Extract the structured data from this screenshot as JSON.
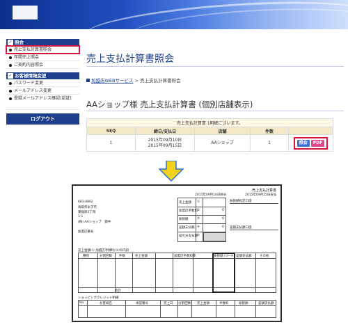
{
  "sidebar": {
    "group1": {
      "title": "照会",
      "items": [
        "売上支払計算書照会",
        "年間売上照会",
        "ご契約内容照会"
      ]
    },
    "group2": {
      "title": "お客様情報変更",
      "items": [
        "パスワード変更",
        "メールアドレス変更",
        "登録メールアドレス確認(認証)"
      ]
    },
    "logout": "ログアウト"
  },
  "main": {
    "title": "売上支払計算書照会",
    "breadcrumb": {
      "link": "加盟店WEBサービス",
      "current": "売上支払計算書照会"
    },
    "subtitle": "AAショップ様 売上支払計算書 (個別店舗表示)",
    "table": {
      "caption": "売上支払計算書 1明細ございます。",
      "headers": [
        "SEQ",
        "締日/支払日",
        "店舗",
        "件数"
      ],
      "row": {
        "seq": "1",
        "close_date": "2015年09月10日",
        "pay_date": "2015年09月15日",
        "shop": "AAショップ",
        "count": "1"
      },
      "view_label": "照会",
      "pdf_label": "PDF"
    }
  },
  "doc": {
    "title": "売上支払計算書",
    "close_date": "2015年09月10日締分",
    "pay_date": "2015年09月15日支払",
    "postal": "683-0802",
    "address1": "鳥取県米子市",
    "address2": "東福原2丁目",
    "address3": "1-1",
    "company": "(株) AAショップ　御中",
    "member_no_label": "加盟店番号",
    "summary": [
      {
        "label": "売上金額",
        "num": "①",
        "value": ""
      },
      {
        "label": "加盟店手数料",
        "num": "②",
        "value": "0"
      },
      {
        "label": "振替額",
        "num": "③",
        "value": "0"
      },
      {
        "label": "差額支払額",
        "num": "④",
        "value": "0"
      },
      {
        "label": "差引お支払額",
        "num": "⑤",
        "value": ""
      }
    ],
    "bank_label": "振替額指定口座",
    "pay_bank_label": "差額支払額口座",
    "section_label": "売上金額(① 加盟店手数料(②)の内訳",
    "col_left": [
      "種別",
      "分割回数",
      "件数",
      "売上金額",
      "加盟店手数料率"
    ],
    "col_right": [
      "振替額 (③~④)",
      "差額支払額",
      "その他"
    ],
    "total_label": "合計",
    "section2_label": "ショッピングクレジット明細",
    "col2": [
      "No.",
      "お客様名",
      "承認番号",
      "売上日",
      "分割回数",
      "売上金額",
      "手数料",
      "振替額",
      "差額支払額"
    ]
  }
}
